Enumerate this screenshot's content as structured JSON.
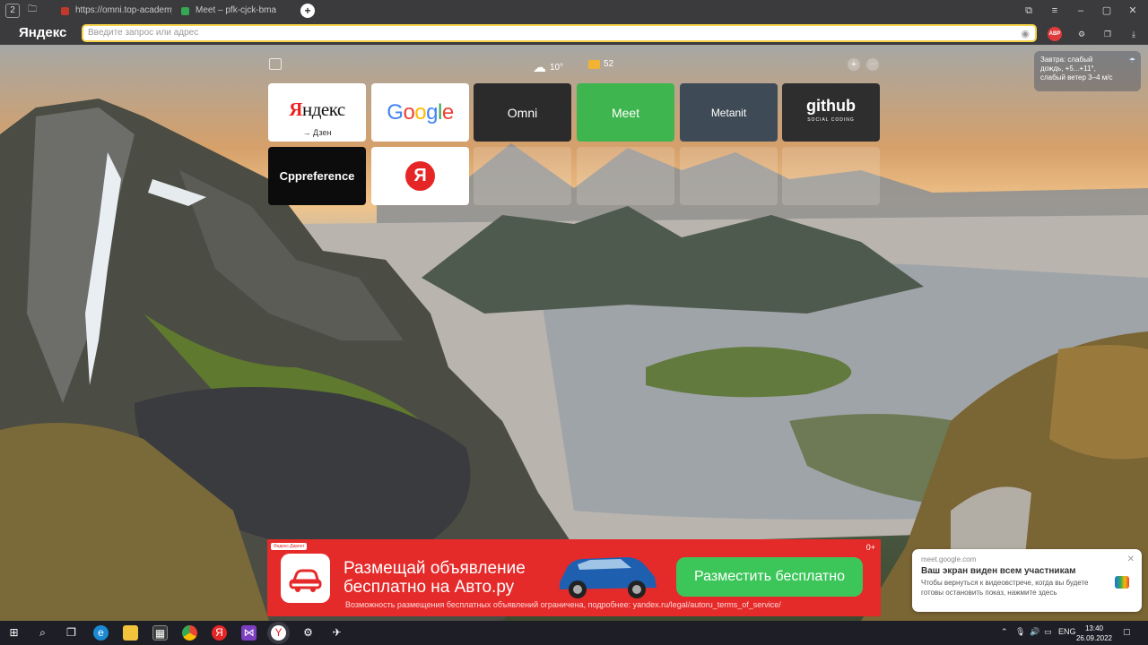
{
  "tabs": [
    {
      "title": "https://omni.top-academy",
      "color": "#c0392b"
    },
    {
      "title": "Meet – pfk-cjck-bma",
      "color": "#34a853"
    }
  ],
  "tabbar": {
    "counter": "2",
    "new_tab": "+"
  },
  "window_controls": {
    "bookmarks": "⧉",
    "menu": "≡",
    "minimize": "–",
    "maximize": "▢",
    "close": "✕"
  },
  "browser": {
    "brand": "Яндекс"
  },
  "omnibox": {
    "placeholder": "Введите запрос или адрес"
  },
  "extensions": {
    "abp": "ABP"
  },
  "widgets": {
    "weather_temp": "10°",
    "mail_count": "52",
    "add": "+",
    "more": "···"
  },
  "weather_card": {
    "line1": "Завтра: слабый",
    "line2": "дождь, +5...+11°,",
    "line3": "слабый ветер 3–4 м/с"
  },
  "tiles": [
    {
      "name": "Яндекс",
      "sub": "→ Дзен",
      "bg": "#ffffff"
    },
    {
      "name": "Google",
      "bg": "#ffffff"
    },
    {
      "name": "Omni",
      "bg": "#2b2b2b"
    },
    {
      "name": "Meet",
      "bg": "#3eb54e"
    },
    {
      "name": "Metanit",
      "bg": "#3e4b56"
    },
    {
      "name": "github",
      "sub": "SOCIAL CODING",
      "bg": "#2e2e2e"
    },
    {
      "name": "Cppreference",
      "bg": "#0c0c0c"
    },
    {
      "name": "Я",
      "bg": "#ffffff"
    }
  ],
  "ad": {
    "tag": "Яндекс.Директ",
    "headline_1": "Размещай объявление",
    "headline_2": "бесплатно на Авто.ру",
    "cta": "Разместить бесплатно",
    "fine_print": "Возможность размещения бесплатных объявлений ограничена, подробнее: yandex.ru/legal/autoru_terms_of_service/",
    "corner": "0+"
  },
  "notification": {
    "source": "meet.google.com",
    "title": "Ваш экран виден всем участникам",
    "body": "Чтобы вернуться к видеовстрече, когда вы будете готовы остановить показ, нажмите здесь"
  },
  "taskbar": {
    "lang": "ENG",
    "time": "13:40",
    "date": "26.09.2022"
  }
}
